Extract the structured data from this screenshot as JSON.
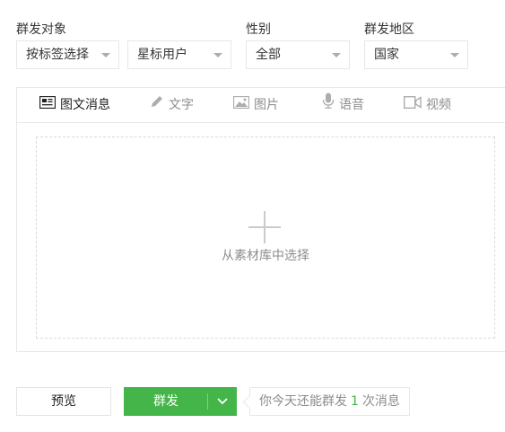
{
  "filters": {
    "target": {
      "label": "群发对象",
      "options": [
        "按标签选择",
        "星标用户"
      ]
    },
    "gender": {
      "label": "性别",
      "value": "全部"
    },
    "region": {
      "label": "群发地区",
      "value": "国家"
    }
  },
  "tabs": [
    {
      "label": "图文消息",
      "icon": "news-icon",
      "active": true
    },
    {
      "label": "文字",
      "icon": "pencil-icon",
      "active": false
    },
    {
      "label": "图片",
      "icon": "image-icon",
      "active": false
    },
    {
      "label": "语音",
      "icon": "microphone-icon",
      "active": false
    },
    {
      "label": "视频",
      "icon": "video-icon",
      "active": false
    }
  ],
  "dropzone": {
    "label": "从素材库中选择",
    "icon": "plus-icon"
  },
  "actions": {
    "preview_label": "预览",
    "send_label": "群发",
    "send_menu_icon": "chevron-down-icon"
  },
  "quota": {
    "prefix": "你今天还能群发",
    "count": "1",
    "suffix": "次消息"
  },
  "colors": {
    "primary": "#44b549",
    "border": "#e7e7eb",
    "muted": "#8d8d8d",
    "text": "#353535"
  }
}
